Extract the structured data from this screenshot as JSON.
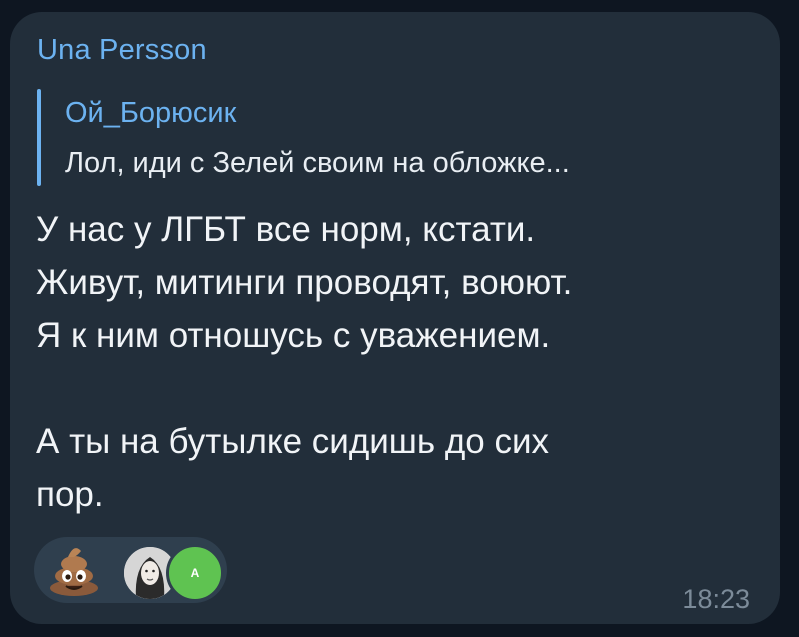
{
  "message": {
    "sender_name": "Una Persson",
    "reply": {
      "author": "Ой_Борюсик",
      "text": "Лол, иди с Зелей своим на обложке..."
    },
    "text": "У нас у ЛГБТ все норм, кстати.\nЖивут, митинги проводят, воюют.\nЯ к ним отношусь с уважением.\n\nА ты на бутылке сидишь до сих\nпор.",
    "time": "18:23"
  },
  "reactions": {
    "emoji_icon": "pile-of-poo-emoji",
    "avatars": [
      {
        "type": "photo",
        "icon": "user-photo-avatar"
      },
      {
        "type": "letter",
        "letter": "A",
        "color": "#5fc351"
      }
    ]
  },
  "colors": {
    "background": "#0e1621",
    "bubble": "#222e3a",
    "accent": "#6cb2f0",
    "reaction_pill": "#2f3f4e",
    "time": "#7c8b99"
  }
}
